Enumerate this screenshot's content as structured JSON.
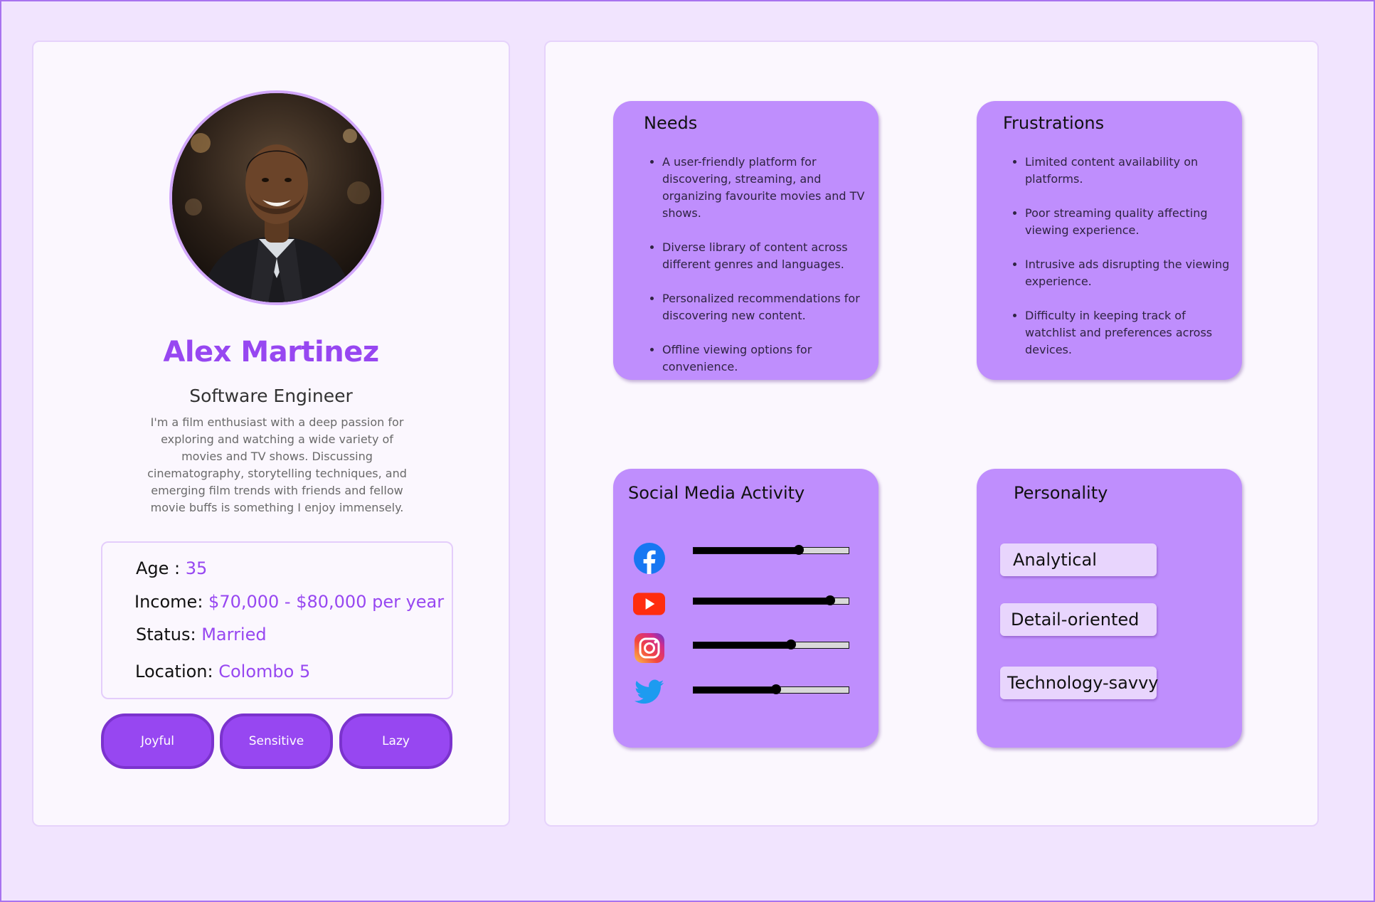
{
  "profile": {
    "name": "Alex Martinez",
    "role": "Software Engineer",
    "bio": "I'm a film enthusiast with a deep passion for exploring and watching a wide variety of movies and TV shows. Discussing cinematography, storytelling techniques, and emerging film trends with friends and fellow movie buffs is something I enjoy immensely.",
    "avatar_alt": "profile-photo"
  },
  "info": {
    "age_label": "Age :",
    "age_value": "35",
    "income_label": "Income:",
    "income_value": "$70,000 - $80,000 per year",
    "status_label": "Status:",
    "status_value": "Married",
    "location_label": "Location:",
    "location_value": "Colombo 5"
  },
  "traits": [
    "Joyful",
    "Sensitive",
    "Lazy"
  ],
  "needs": {
    "title": "Needs",
    "items": [
      "A user-friendly platform for discovering, streaming, and organizing favourite movies and TV shows.",
      "Diverse library of content across different genres and languages.",
      "Personalized recommendations for discovering new content.",
      "Offline viewing options for convenience."
    ]
  },
  "frustrations": {
    "title": "Frustrations",
    "items": [
      "Limited content availability on platforms.",
      "Poor streaming quality affecting viewing experience.",
      "Intrusive ads disrupting the viewing experience.",
      "Difficulty in keeping track of watchlist and preferences across devices."
    ]
  },
  "social": {
    "title": "Social Media Activity",
    "platforms": [
      {
        "icon": "facebook-icon",
        "level": 0.68
      },
      {
        "icon": "youtube-icon",
        "level": 0.88
      },
      {
        "icon": "instagram-icon",
        "level": 0.63
      },
      {
        "icon": "twitter-icon",
        "level": 0.53
      }
    ]
  },
  "personality": {
    "title": "Personality",
    "tags": [
      "Analytical",
      "Detail-oriented",
      "Technology-savvy"
    ]
  },
  "colors": {
    "background": "#f1e4fe",
    "accent": "#9747f1",
    "card": "#bf8efd",
    "tag": "#e8d5fd"
  }
}
